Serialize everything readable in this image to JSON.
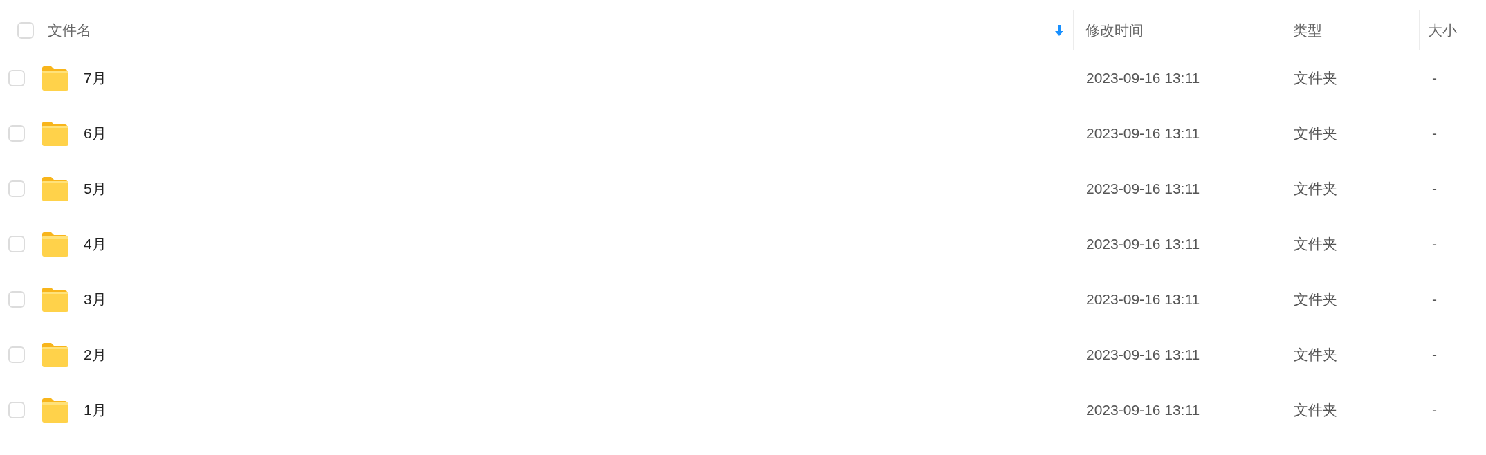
{
  "table": {
    "select_all": {
      "checked": false
    },
    "columns": [
      {
        "label": "文件名",
        "sorted": true
      },
      {
        "label": "修改时间",
        "sorted": false
      },
      {
        "label": "类型",
        "sorted": false
      },
      {
        "label": "大小",
        "sorted": false
      }
    ],
    "rows": [
      {
        "checked": false,
        "name": "7月",
        "modified": "2023-09-16 13:11",
        "type": "文件夹",
        "size": "-"
      },
      {
        "checked": false,
        "name": "6月",
        "modified": "2023-09-16 13:11",
        "type": "文件夹",
        "size": "-"
      },
      {
        "checked": false,
        "name": "5月",
        "modified": "2023-09-16 13:11",
        "type": "文件夹",
        "size": "-"
      },
      {
        "checked": false,
        "name": "4月",
        "modified": "2023-09-16 13:11",
        "type": "文件夹",
        "size": "-"
      },
      {
        "checked": false,
        "name": "3月",
        "modified": "2023-09-16 13:11",
        "type": "文件夹",
        "size": "-"
      },
      {
        "checked": false,
        "name": "2月",
        "modified": "2023-09-16 13:11",
        "type": "文件夹",
        "size": "-"
      },
      {
        "checked": false,
        "name": "1月",
        "modified": "2023-09-16 13:11",
        "type": "文件夹",
        "size": "-"
      }
    ]
  }
}
